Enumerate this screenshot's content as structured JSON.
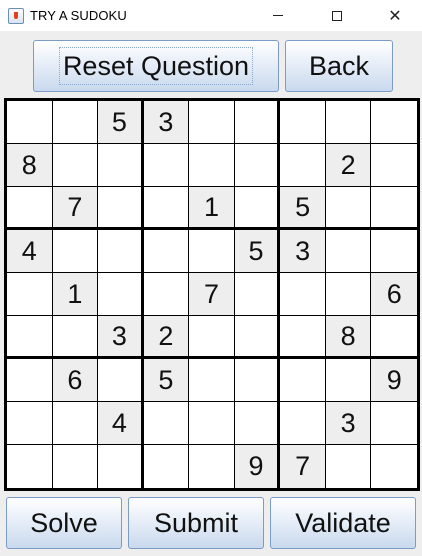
{
  "window": {
    "title": "TRY A SUDOKU",
    "minimize_glyph": "minimize",
    "maximize_glyph": "maximize",
    "close_glyph": "✕"
  },
  "top_buttons": {
    "reset_label": "Reset Question",
    "back_label": "Back"
  },
  "bottom_buttons": {
    "solve_label": "Solve",
    "submit_label": "Submit",
    "validate_label": "Validate"
  },
  "board": [
    [
      "",
      "",
      "5",
      "3",
      "",
      "",
      "",
      "",
      ""
    ],
    [
      "8",
      "",
      "",
      "",
      "",
      "",
      "",
      "2",
      ""
    ],
    [
      "",
      "7",
      "",
      "",
      "1",
      "",
      "5",
      "",
      ""
    ],
    [
      "4",
      "",
      "",
      "",
      "",
      "5",
      "3",
      "",
      ""
    ],
    [
      "",
      "1",
      "",
      "",
      "7",
      "",
      "",
      "",
      "6"
    ],
    [
      "",
      "",
      "3",
      "2",
      "",
      "",
      "",
      "8",
      ""
    ],
    [
      "",
      "6",
      "",
      "5",
      "",
      "",
      "",
      "",
      "9"
    ],
    [
      "",
      "",
      "4",
      "",
      "",
      "",
      "",
      "3",
      ""
    ],
    [
      "",
      "",
      "",
      "",
      "",
      "9",
      "7",
      "",
      ""
    ]
  ],
  "colors": {
    "given_cell_bg": "#eeeeee",
    "empty_cell_bg": "#ffffff",
    "button_border": "#7a9cc6"
  }
}
